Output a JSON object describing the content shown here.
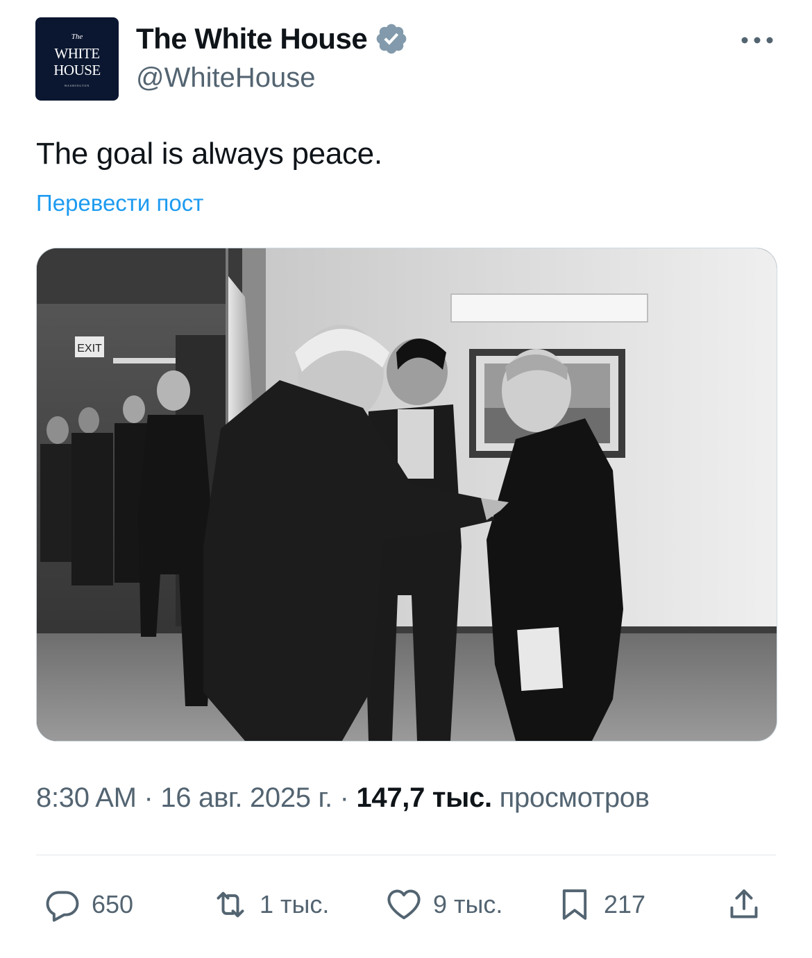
{
  "account": {
    "avatar": {
      "the": "The",
      "line1": "WHITE",
      "line2": "HOUSE",
      "small": "WASHINGTON"
    },
    "name": "The White House",
    "handle": "@WhiteHouse",
    "verified_icon": "verified-badge-icon",
    "more_icon": "more-options-icon"
  },
  "post": {
    "text": "The goal is always peace.",
    "translate": "Перевести пост",
    "image_sign": "EXIT"
  },
  "meta": {
    "time": "8:30 AM",
    "sep1": " · ",
    "date": "16 авг. 2025 г.",
    "sep2": " · ",
    "views_count": "147,7 тыс.",
    "views_label": " просмотров"
  },
  "actions": {
    "replies": "650",
    "reposts": "1 тыс.",
    "likes": "9 тыс.",
    "bookmarks": "217"
  },
  "colors": {
    "accent": "#1d9bf0",
    "secondary_text": "#536471",
    "text": "#0f1419"
  }
}
